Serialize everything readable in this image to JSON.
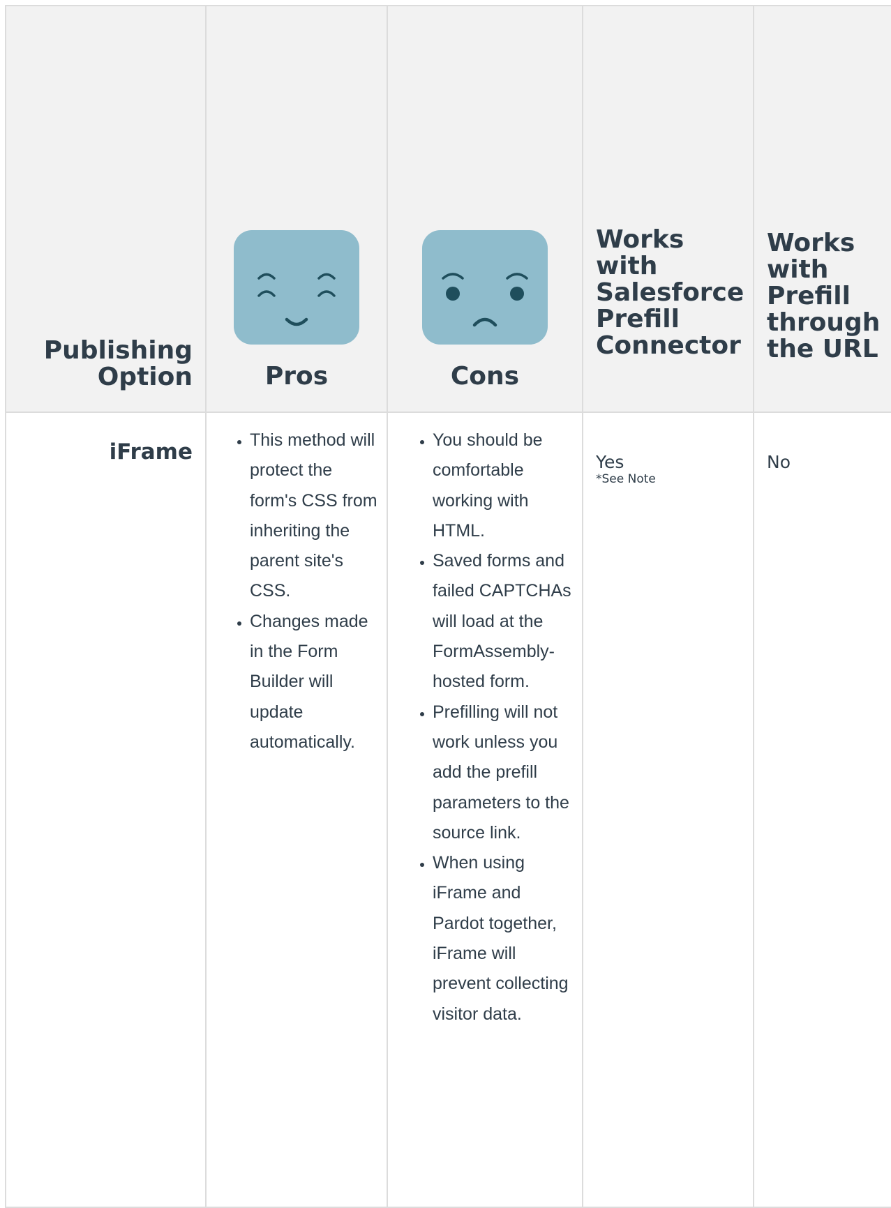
{
  "header": {
    "option": "Publishing Option",
    "option_line1": "Publishing",
    "option_line2": "Option",
    "pros": "Pros",
    "cons": "Cons",
    "salesforce": [
      "Works",
      "with",
      "Salesforce",
      "Prefill",
      "Connector"
    ],
    "url": [
      "Works",
      "with",
      "Prefill",
      "through",
      "the URL"
    ],
    "pros_icon": "happy-face-icon",
    "cons_icon": "sad-face-icon",
    "face_color": "#8fbccc"
  },
  "rows": [
    {
      "option": "iFrame",
      "pros": [
        "This method will protect the form's CSS from inheriting the parent site's CSS.",
        "Changes made in the Form Builder will update automatically."
      ],
      "cons": [
        "You should be comfortable working with HTML.",
        "Saved forms and failed CAPTCHAs will load at the FormAssembly-hosted form.",
        "Prefilling will not work unless you add the prefill parameters to the source link.",
        "When using iFrame and Pardot together, iFrame will prevent collecting visitor data."
      ],
      "salesforce": "Yes",
      "salesforce_note": "*See Note",
      "url": "No"
    }
  ]
}
